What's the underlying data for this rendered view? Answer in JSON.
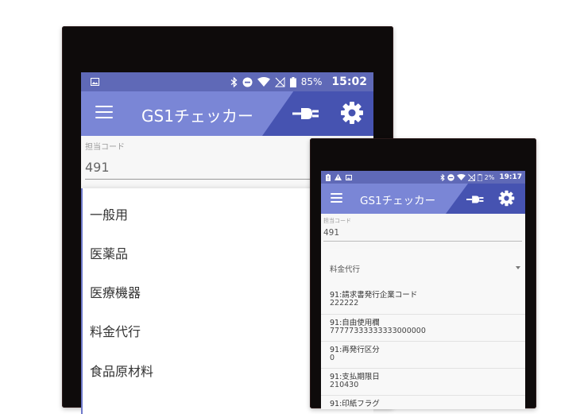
{
  "tablet": {
    "status": {
      "battery": "85%",
      "time": "15:02"
    },
    "app_title": "GS1チェッカー",
    "tanto": {
      "label": "担当コード",
      "value": "491"
    },
    "menu_items": [
      "一般用",
      "医薬品",
      "医療機器",
      "料金代行",
      "食品原材料"
    ]
  },
  "phone": {
    "status": {
      "battery": "2%",
      "time": "19:17"
    },
    "app_title": "GS1チェッカー",
    "tanto": {
      "label": "担当コード",
      "value": "491"
    },
    "selected_category": "料金代行",
    "fields": [
      {
        "label": "91:請求書発行企業コード",
        "value": "222222"
      },
      {
        "label": "91:自由使用欄",
        "value": "77777333333333000000"
      },
      {
        "label": "91:再発行区分",
        "value": "0"
      },
      {
        "label": "91:支払期限日",
        "value": "210430"
      },
      {
        "label": "91:印紙フラグ",
        "value": ""
      }
    ]
  },
  "colors": {
    "appbar": "#7a86d6",
    "appbar_dark": "#4653b1",
    "statusbar": "#5f69b7"
  }
}
